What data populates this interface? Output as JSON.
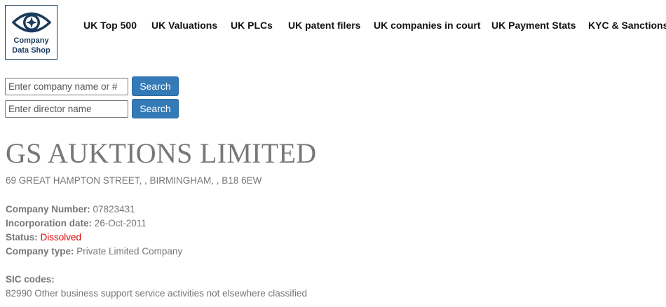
{
  "logo": {
    "line1": "Company",
    "line2": "Data Shop"
  },
  "nav": [
    "UK Top 500",
    "UK Valuations",
    "UK PLCs",
    "UK patent filers",
    "UK companies in court",
    "UK Payment Stats",
    "KYC & Sanctions"
  ],
  "search": {
    "company_placeholder": "Enter company name or #",
    "director_placeholder": "Enter director name",
    "button_label": "Search"
  },
  "company": {
    "name": "GS AUKTIONS LIMITED",
    "address": "69 GREAT HAMPTON STREET, , BIRMINGHAM, , B18 6EW",
    "number_label": "Company Number:",
    "number": "07823431",
    "incorporation_label": "Incorporation date:",
    "incorporation": "26-Oct-2011",
    "status_label": "Status:",
    "status": "Dissolved",
    "type_label": "Company type:",
    "type": "Private Limited Company",
    "sic_label": "SIC codes:",
    "sic": "82990 Other business support service activities not elsewhere classified"
  },
  "colors": {
    "brand": "#1b3a5c",
    "button": "#337ab7",
    "status_dissolved": "#e00000"
  }
}
